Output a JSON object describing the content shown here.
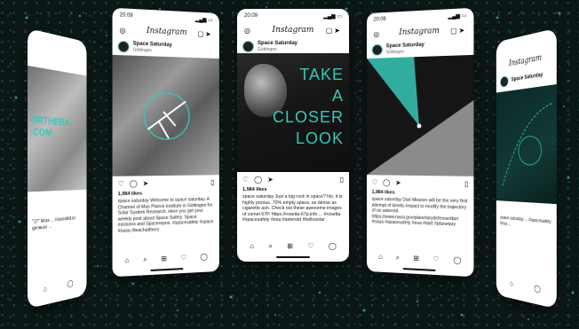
{
  "status": {
    "time": "20:09"
  },
  "app": {
    "logo": "Instagram"
  },
  "account": {
    "name": "Space Saturday",
    "subtitle": "Göttingen"
  },
  "phones": [
    {
      "post_text": "ORTHERA\n.COM",
      "caption": "\"17\" Mass … Kinderbild ist genauso …"
    },
    {
      "likes": "1,984 likes",
      "caption": "space saturday Welcome to space saturday. A Channel of Max Planck Institute in Göttingen for Solar System Research. Here you get your weekly post about Space Safety. Space missions and Spacerepos. #spacesafety #space #nasa #teachatthers"
    },
    {
      "headline": [
        "TAKE",
        "A",
        "CLOSER",
        "LOOK"
      ],
      "likes": "1,984 likes",
      "caption": "space saturday Just a big rock in space? No, it is highly porous. 70% empty space, as dense as cigarette ash. Check out these awesome images of comet 67P. https://rosetta-67p.info ... #rosetta #spacesafety #esa #asteroid #hellosolar"
    },
    {
      "likes": "1,984 likes",
      "caption": "space saturday Dart Mission will be the very first attempt of kinetic impact to modify the trajectory of an asteroid. https://www.nasa.gov/planetarydefense/dart #nasa #spacesafety #esa #dart #planetary"
    },
    {
      "caption": "space saturday ... #spacesafety #esa ..."
    }
  ],
  "icons": [
    "camera-icon",
    "igtv-icon",
    "send-icon",
    "heart-icon",
    "comment-icon",
    "share-icon",
    "bookmark-icon",
    "home-icon",
    "search-icon",
    "add-icon",
    "profile-icon"
  ],
  "colors": {
    "accent": "#38c7b8",
    "background": "#0b1716"
  }
}
